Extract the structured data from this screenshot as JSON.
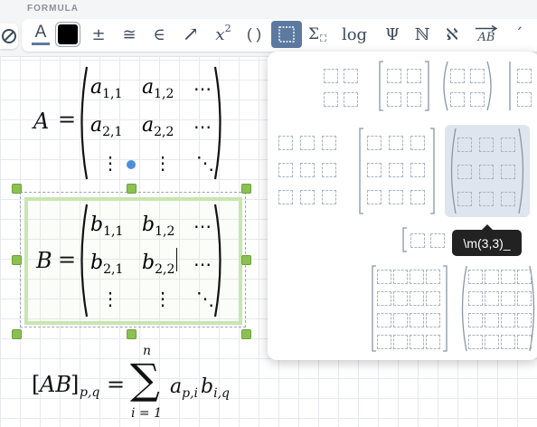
{
  "toolbar": {
    "section_title": "FORMULA",
    "text_color_label": "A",
    "plus_minus": "±",
    "congruent": "≅",
    "element_of": "∈",
    "arrow": "↗",
    "superscript_x": "x",
    "superscript_2": "2",
    "parens": "( )",
    "sum_symbol": "Σ",
    "log_label": "log",
    "psi": "Ψ",
    "naturals": "ℕ",
    "aleph": "ℵ",
    "vector_ab": "AB",
    "accent": "´"
  },
  "colors": {
    "accent": "#5c7aa0",
    "handle": "#8cc152",
    "selection": "#c8e6b0",
    "tooltip_bg": "#222222",
    "cursor_dot": "#4a8fd8"
  },
  "canvas": {
    "eq_a": {
      "lhs": "A",
      "equals": "=",
      "cells": [
        {
          "base": "a",
          "sub": "1,1"
        },
        {
          "base": "a",
          "sub": "1,2"
        },
        {
          "base": "⋯",
          "sub": ""
        },
        {
          "base": "a",
          "sub": "2,1"
        },
        {
          "base": "a",
          "sub": "2,2"
        },
        {
          "base": "⋯",
          "sub": ""
        },
        {
          "base": "⋮",
          "sub": ""
        },
        {
          "base": "⋮",
          "sub": ""
        },
        {
          "base": "⋱",
          "sub": ""
        }
      ]
    },
    "eq_b": {
      "lhs": "B",
      "equals": "=",
      "cells": [
        {
          "base": "b",
          "sub": "1,1"
        },
        {
          "base": "b",
          "sub": "1,2"
        },
        {
          "base": "⋯",
          "sub": ""
        },
        {
          "base": "b",
          "sub": "2,1"
        },
        {
          "base": "b",
          "sub": "2,2"
        },
        {
          "base": "⋯",
          "sub": ""
        },
        {
          "base": "⋮",
          "sub": ""
        },
        {
          "base": "⋮",
          "sub": ""
        },
        {
          "base": "⋱",
          "sub": ""
        }
      ]
    },
    "eq_sum": {
      "open": "[",
      "ab": "AB",
      "close": "]",
      "sub": "p,q",
      "equals": "=",
      "sum": "∑",
      "upper": "n",
      "lower": "i = 1",
      "a": "a",
      "a_sub": "p,i",
      "b": "b",
      "b_sub": "i,q"
    }
  },
  "dropdown": {
    "tooltip": "\\m(3,3)_"
  }
}
